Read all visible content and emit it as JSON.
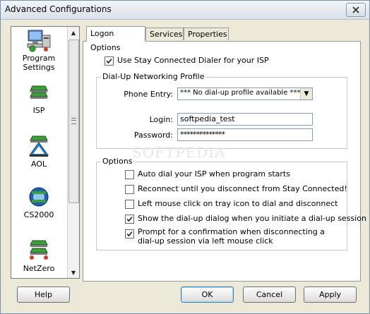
{
  "window": {
    "title": "Advanced Configurations"
  },
  "sidebar": {
    "items": [
      {
        "label": "Program Settings",
        "icon": "program-settings-icon"
      },
      {
        "label": "ISP",
        "icon": "isp-icon"
      },
      {
        "label": "AOL",
        "icon": "aol-icon"
      },
      {
        "label": "CS2000",
        "icon": "cs2000-icon"
      },
      {
        "label": "NetZero",
        "icon": "netzero-icon"
      }
    ]
  },
  "tabs": [
    {
      "label": "Logon Options",
      "active": true
    },
    {
      "label": "Services",
      "active": false
    },
    {
      "label": "Properties",
      "active": false
    }
  ],
  "logon": {
    "use_dialer_label": "Use Stay Connected Dialer for your ISP",
    "use_dialer_checked": true,
    "dialup_group_label": "Dial-Up Networking Profile",
    "phone_entry_label": "Phone Entry:",
    "phone_entry_value": "*** No dial-up profile available ***",
    "login_label": "Login:",
    "login_value": "softpedia_test",
    "password_label": "Password:",
    "password_value": "**************"
  },
  "options": {
    "group_label": "Options",
    "items": [
      {
        "label": "Auto dial your ISP when program starts",
        "checked": false
      },
      {
        "label": "Reconnect until you disconnect from Stay Connected!",
        "checked": false
      },
      {
        "label": "Left mouse click on tray icon to dial and disconnect",
        "checked": false
      },
      {
        "label": "Show the dial-up dialog when you initiate a dial-up session",
        "checked": true
      },
      {
        "label": "Prompt for a confirmation when disconnecting a dial-up session via left mouse click",
        "checked": true
      }
    ]
  },
  "watermark": "SOFTPEDIA",
  "buttons": {
    "help": "Help",
    "ok": "OK",
    "cancel": "Cancel",
    "apply": "Apply"
  }
}
